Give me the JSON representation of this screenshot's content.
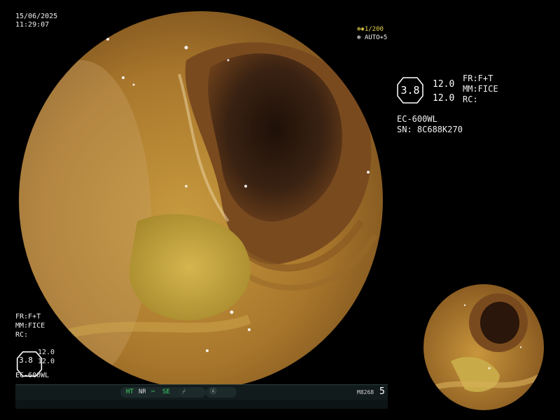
{
  "overlay": {
    "date": "15/06/2025",
    "time": "11:29:07",
    "shutter": "1/200",
    "shutter_icon": "shutter-icon",
    "auto_mode": "AUTO+5",
    "auto_icon": "auto-icon"
  },
  "params": {
    "enhance": "3.8",
    "value_1": "12.0",
    "value_2": "12.0"
  },
  "scope": {
    "model": "EC-600WL",
    "serial": "SN: 8C688K270"
  },
  "modes": {
    "fr": "FR:F+T",
    "mm": "MM:FICE",
    "rc": "RC:"
  },
  "statusbar": {
    "ht": "HT",
    "nr": "NR",
    "se": "SE",
    "se_icon": "scissors-icon",
    "slot_icon": "slash-icon",
    "circle_icon": "circle-a-icon",
    "code": "M8268",
    "number": "5",
    "accent": "#3ddc6a"
  },
  "colors": {
    "background": "#000000",
    "tissue": "#b7862e",
    "lumen": "#3a2212"
  }
}
